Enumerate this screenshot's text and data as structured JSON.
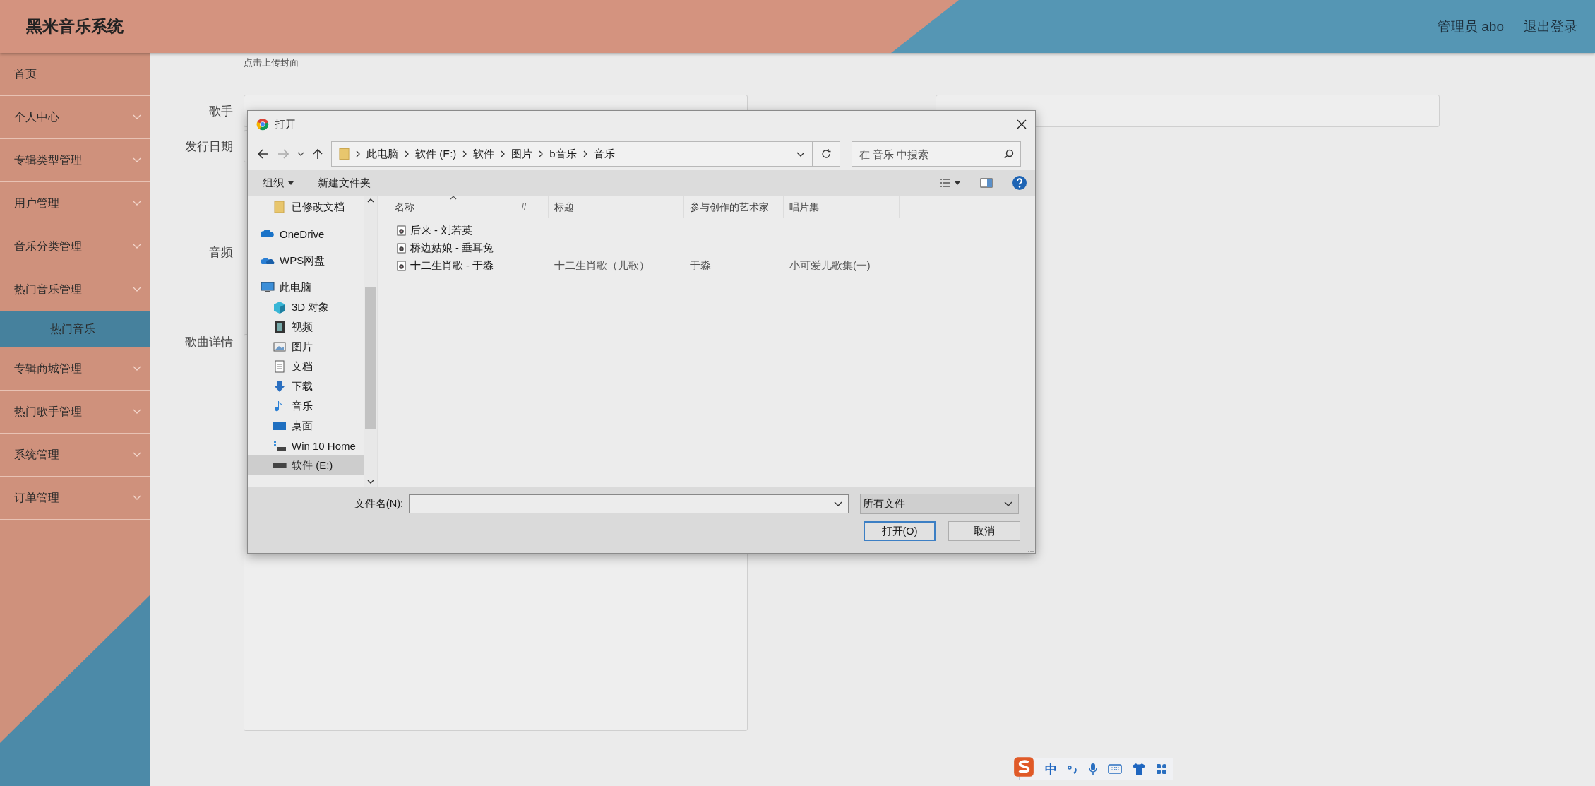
{
  "header": {
    "title": "黑米音乐系统",
    "user": "管理员 abo",
    "logout": "退出登录"
  },
  "sidebar": {
    "items": [
      {
        "label": "首页",
        "kind": "link",
        "selected": false
      },
      {
        "label": "个人中心",
        "kind": "menu",
        "selected": false
      },
      {
        "label": "专辑类型管理",
        "kind": "menu",
        "selected": false
      },
      {
        "label": "用户管理",
        "kind": "menu",
        "selected": false
      },
      {
        "label": "音乐分类管理",
        "kind": "menu",
        "selected": false
      },
      {
        "label": "热门音乐管理",
        "kind": "menu",
        "selected": false,
        "children": [
          {
            "label": "热门音乐",
            "selected": true
          }
        ]
      },
      {
        "label": "专辑商城管理",
        "kind": "menu",
        "selected": false
      },
      {
        "label": "热门歌手管理",
        "kind": "menu",
        "selected": false
      },
      {
        "label": "系统管理",
        "kind": "menu",
        "selected": false
      },
      {
        "label": "订单管理",
        "kind": "menu",
        "selected": false
      }
    ]
  },
  "form": {
    "cover_hint": "点击上传封面",
    "rows": [
      {
        "fields": [
          {
            "label": "歌手",
            "kind": "input"
          },
          {
            "kind": "input"
          }
        ]
      },
      {
        "fields": [
          {
            "label": "发行日期",
            "kind": "input"
          }
        ]
      },
      {
        "fields": [
          {
            "label": "音频",
            "kind": "none"
          }
        ]
      },
      {
        "fields": [
          {
            "label": "歌曲详情",
            "kind": "textarea"
          }
        ]
      }
    ]
  },
  "dialog": {
    "title": "打开",
    "breadcrumb": [
      "此电脑",
      "软件 (E:)",
      "软件",
      "图片",
      "b音乐",
      "音乐"
    ],
    "search_placeholder": "在 音乐 中搜索",
    "toolbar": [
      "组织",
      "新建文件夹"
    ],
    "nav": [
      {
        "children": [
          {
            "label": "已修改文档",
            "kind": "folder",
            "selected": false
          }
        ]
      },
      {
        "label": "OneDrive",
        "kind": "cloud",
        "selected": false
      },
      {
        "label": "WPS网盘",
        "kind": "clouds",
        "selected": false
      },
      {
        "label": "此电脑",
        "kind": "computer",
        "selected": false,
        "children": [
          {
            "label": "3D 对象",
            "kind": "cube",
            "selected": false
          },
          {
            "label": "视频",
            "kind": "film",
            "selected": false
          },
          {
            "label": "图片",
            "kind": "image",
            "selected": false
          },
          {
            "label": "文档",
            "kind": "document",
            "selected": false
          },
          {
            "label": "下载",
            "kind": "download",
            "selected": false
          },
          {
            "label": "音乐",
            "kind": "music",
            "selected": false
          },
          {
            "label": "桌面",
            "kind": "desktop",
            "selected": false
          },
          {
            "label": "Win 10 Home",
            "kind": "network",
            "selected": false
          },
          {
            "label": "软件 (E:)",
            "kind": "drive",
            "selected": true
          }
        ]
      }
    ],
    "columns": [
      "名称",
      "#",
      "标题",
      "参与创作的艺术家",
      "唱片集"
    ],
    "files": [
      {
        "name": "后来 - 刘若英"
      },
      {
        "name": "桥边姑娘 - 垂耳兔"
      },
      {
        "name": "十二生肖歌 - 于淼",
        "title": "十二生肖歌（儿歌）",
        "artist": "于淼",
        "album": "小可爱儿歌集(一)"
      }
    ],
    "filename_label": "文件名(N):",
    "file_type": "所有文件",
    "buttons": [
      {
        "label": "打开(O)",
        "kind": "primary"
      },
      {
        "label": "取消",
        "kind": "secondary"
      }
    ]
  },
  "ime": {
    "mode": "中"
  }
}
